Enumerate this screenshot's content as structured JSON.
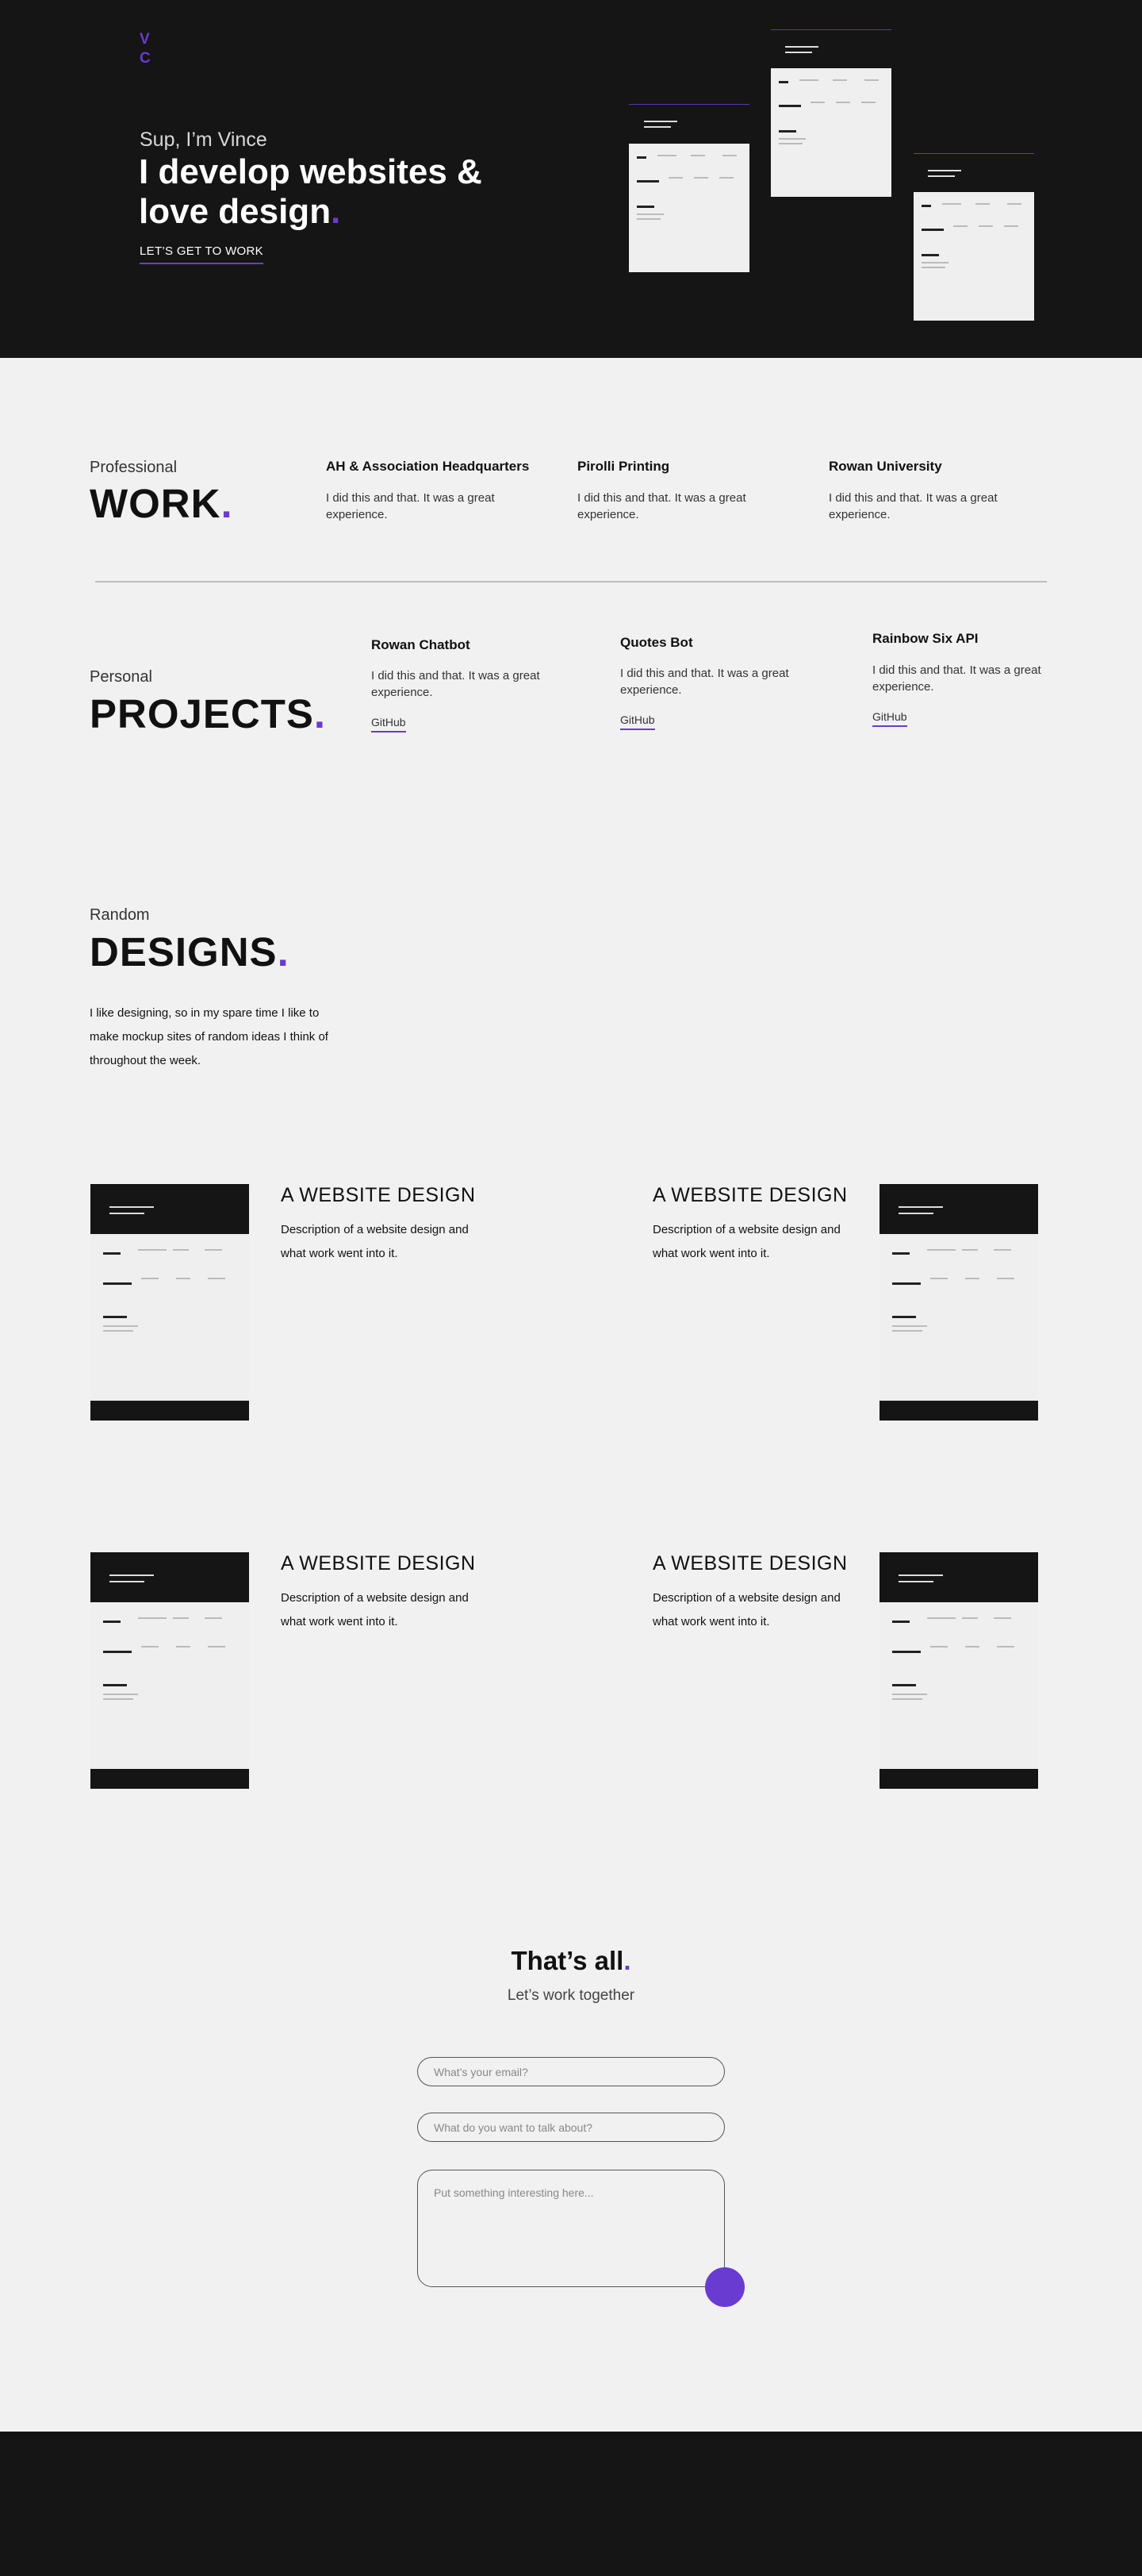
{
  "hero": {
    "logo_top": "V",
    "logo_bottom": "C",
    "greeting": "Sup, I’m Vince",
    "headline": "I develop websites & love design",
    "headline_dot": ".",
    "cta": "LET’S GET TO WORK"
  },
  "work": {
    "label_small": "Professional",
    "label_big": "WORK",
    "dot": ".",
    "items": [
      {
        "title": "AH & Association Headquarters",
        "desc": "I did this and that. It was a great experience."
      },
      {
        "title": "Pirolli Printing",
        "desc": "I did this and that. It was a great experience."
      },
      {
        "title": "Rowan University",
        "desc": "I did this and that. It was a great experience."
      }
    ]
  },
  "projects": {
    "label_small": "Personal",
    "label_big": "PROJECTS",
    "dot": ".",
    "items": [
      {
        "title": "Rowan Chatbot",
        "desc": "I did this and that. It was a great experience.",
        "link": "GitHub"
      },
      {
        "title": "Quotes Bot",
        "desc": "I did this and that. It was a great experience.",
        "link": "GitHub"
      },
      {
        "title": "Rainbow Six API",
        "desc": "I did this and that. It was a great experience.",
        "link": "GitHub"
      }
    ]
  },
  "designs": {
    "label_small": "Random",
    "label_big": "DESIGNS",
    "dot": ".",
    "intro": "I like designing, so in my spare time I like to make mockup sites of random ideas I think of throughout the week.",
    "cards": [
      {
        "title": "A WEBSITE DESIGN",
        "desc": "Description of a website design and what work went into it."
      },
      {
        "title": "A WEBSITE DESIGN",
        "desc": "Description of a website design and what work went into it."
      },
      {
        "title": "A WEBSITE DESIGN",
        "desc": "Description of a website design and what work went into it."
      },
      {
        "title": "A WEBSITE DESIGN",
        "desc": "Description of a website design and what work went into it."
      }
    ]
  },
  "contact": {
    "title": "That’s all",
    "dot": ".",
    "subtitle": "Let’s work together",
    "email_placeholder": "What’s your email?",
    "topic_placeholder": "What do you want to talk about?",
    "message_placeholder": "Put something interesting here..."
  },
  "colors": {
    "accent": "#6a3bd1",
    "dark": "#151515",
    "light": "#f1f1f1"
  }
}
